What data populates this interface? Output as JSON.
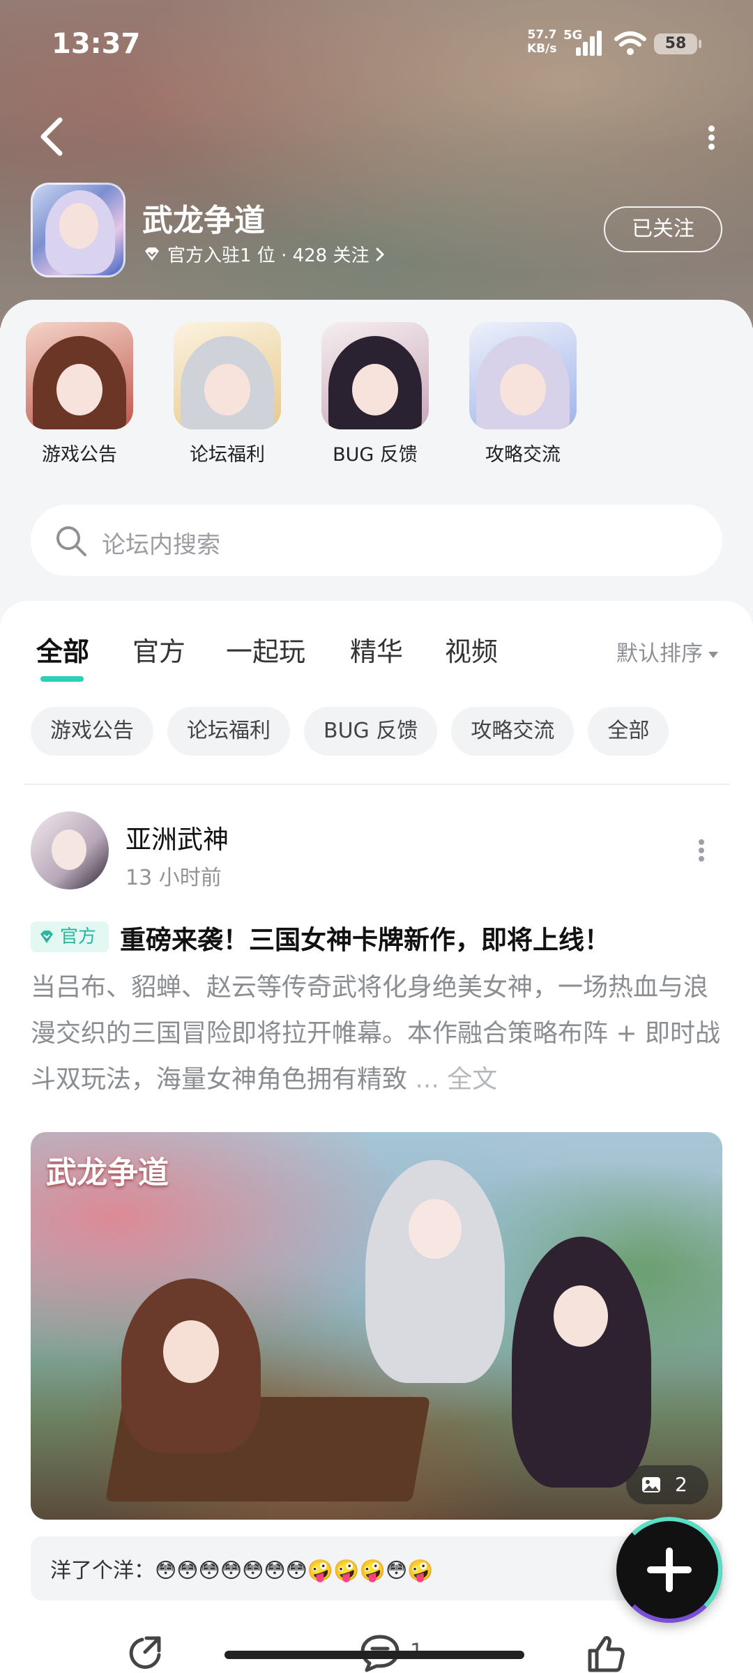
{
  "status_bar": {
    "time": "13:37",
    "net_speed": "57.7",
    "net_unit": "KB/s",
    "network": "5G",
    "battery": "58"
  },
  "header": {
    "app_name": "武龙争道",
    "meta": "官方入驻1 位 · 428 关注",
    "follow_label": "已关注"
  },
  "sections": [
    {
      "label": "游戏公告",
      "hair": "#6b3626"
    },
    {
      "label": "论坛福利",
      "hair": "#cfd2d8"
    },
    {
      "label": "BUG 反馈",
      "hair": "#2a2230"
    },
    {
      "label": "攻略交流",
      "hair": "#d8d1ea"
    }
  ],
  "search": {
    "placeholder": "论坛内搜索"
  },
  "tabs": [
    "全部",
    "官方",
    "一起玩",
    "精华",
    "视频"
  ],
  "sort_label": "默认排序",
  "chips": [
    "游戏公告",
    "论坛福利",
    "BUG 反馈",
    "攻略交流",
    "全部"
  ],
  "post": {
    "author": "亚洲武神",
    "time_ago": "13 小时前",
    "tag": "官方",
    "title": "重磅来袭！三国女神卡牌新作，即将上线！",
    "body": "当吕布、貂蝉、赵云等传奇武将化身绝美女神，一场热血与浪漫交织的三国冒险即将拉开帷幕。本作融合策略布阵 + 即时战斗双玩法，海量女神角色拥有精致",
    "body_more": "... 全文",
    "image_logo": "武龙争道",
    "image_count": "2",
    "comment": "洋了个洋：😳😳😳😳😳😳😳🤪🤪🤪😳🤪",
    "comment_count": "1"
  },
  "colors": {
    "accent": "#2cd1b5",
    "official_tag": "#2bb59c"
  }
}
